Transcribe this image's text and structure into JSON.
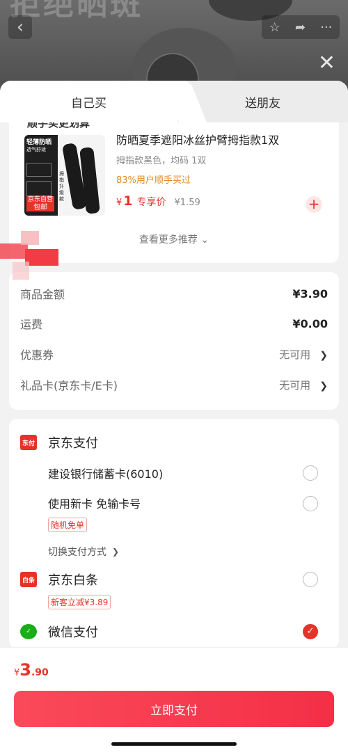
{
  "background": {
    "title": "拒绝晒斑",
    "back_icon": "chevron-left-icon",
    "tool_icons": [
      "star-icon",
      "share-icon",
      "more-icon"
    ]
  },
  "tabs": [
    {
      "label": "自己买",
      "active": true
    },
    {
      "label": "送朋友",
      "active": false
    }
  ],
  "recommend": {
    "header": "顺手买更划算",
    "product": {
      "thumb_text_top": "轻薄防晒",
      "thumb_text_sub": "透气舒适",
      "thumb_badge": "京东自营",
      "thumb_badge2": "包邮",
      "thumb_side": "拇指升级款",
      "name": "防晒夏季遮阳冰丝护臂拇指款1双",
      "spec": "拇指款黑色，均码 1双",
      "buyers": "83%用户顺手买过",
      "price_symbol": "¥",
      "price": "1",
      "price_tag": "专享价",
      "old_price": "¥1.59"
    },
    "more": "查看更多推荐 ⌄"
  },
  "fees": [
    {
      "label": "商品金额",
      "value": "¥3.90",
      "chevron": false
    },
    {
      "label": "运费",
      "value": "¥0.00",
      "chevron": false
    },
    {
      "label": "优惠券",
      "value": "无可用",
      "chevron": true
    },
    {
      "label": "礼品卡(京东卡/E卡)",
      "value": "无可用",
      "chevron": true
    }
  ],
  "payment": {
    "jd_pay": {
      "title": "京东支付",
      "logo_text": "东付"
    },
    "card1": "建设银行储蓄卡(6010)",
    "card2": "使用新卡 免输卡号",
    "card2_chip": "随机免单",
    "switch": "切换支付方式",
    "baitiao": {
      "title": "京东白条",
      "logo_text": "白条",
      "chip": "新客立减¥3.89"
    },
    "wechat": {
      "title": "微信支付",
      "checked": true
    }
  },
  "footer": {
    "yen": "¥",
    "int": "3",
    "dec": ".90",
    "button": "立即支付"
  }
}
